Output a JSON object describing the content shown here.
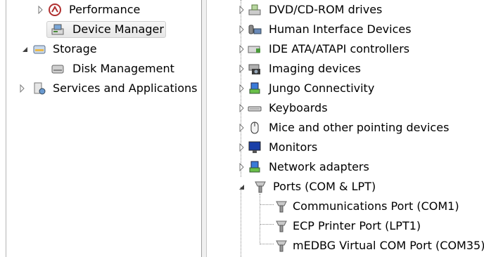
{
  "left_tree": {
    "items": [
      {
        "label": "Performance",
        "icon": "performance-icon"
      },
      {
        "label": "Device Manager",
        "icon": "device-manager-icon",
        "selected": true
      },
      {
        "label": "Storage",
        "icon": "storage-icon",
        "expanded": true
      },
      {
        "label": "Disk Management",
        "icon": "disk-management-icon"
      },
      {
        "label": "Services and Applications",
        "icon": "services-applications-icon"
      }
    ]
  },
  "device_tree": {
    "items": [
      {
        "label": "DVD/CD-ROM drives",
        "icon": "dvd-drive-icon"
      },
      {
        "label": "Human Interface Devices",
        "icon": "hid-icon"
      },
      {
        "label": "IDE ATA/ATAPI controllers",
        "icon": "ide-controller-icon"
      },
      {
        "label": "Imaging devices",
        "icon": "camera-icon"
      },
      {
        "label": "Jungo Connectivity",
        "icon": "jungo-icon"
      },
      {
        "label": "Keyboards",
        "icon": "keyboard-icon"
      },
      {
        "label": "Mice and other pointing devices",
        "icon": "mouse-icon"
      },
      {
        "label": "Monitors",
        "icon": "monitor-icon"
      },
      {
        "label": "Network adapters",
        "icon": "network-adapter-icon"
      },
      {
        "label": "Ports (COM & LPT)",
        "icon": "port-icon",
        "expanded": true
      },
      {
        "label": "Communications Port (COM1)",
        "icon": "port-icon"
      },
      {
        "label": "ECP Printer Port (LPT1)",
        "icon": "port-icon"
      },
      {
        "label": "mEDBG Virtual COM Port (COM35)",
        "icon": "port-icon"
      }
    ]
  },
  "colors": {
    "selection_border": "#cfcfcf",
    "tree_lines": "#8a8a8a",
    "expander": "#7a7a7a"
  }
}
